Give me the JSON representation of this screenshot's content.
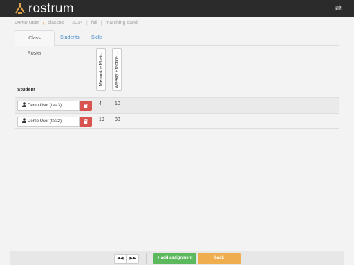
{
  "app": {
    "name": "rostrum",
    "logo_icon": "lectern-icon",
    "swap_icon": "swap-arrows-icon"
  },
  "breadcrumb": {
    "user": "Demo User",
    "items": [
      "classes",
      "2014",
      "fall",
      "marching band"
    ]
  },
  "tabs": [
    {
      "label": "Class Roster",
      "active": true
    },
    {
      "label": "Students",
      "active": false
    },
    {
      "label": "Skills",
      "active": false
    }
  ],
  "table": {
    "student_header": "Student",
    "columns": [
      "Memorize Music",
      "Weekly Practice ..."
    ],
    "rows": [
      {
        "student": "Demo User (test3)",
        "values": [
          "4",
          "10"
        ]
      },
      {
        "student": "Demo User (test2)",
        "values": [
          "19",
          "33"
        ]
      }
    ]
  },
  "footer": {
    "prev_glyph": "◀◀",
    "next_glyph": "▶▶",
    "add_label": "add assignment",
    "add_glyph": "+",
    "back_label": "back"
  },
  "colors": {
    "header_bg": "#2b2b2b",
    "accent": "#f0ad4e",
    "link": "#428bca",
    "danger": "#d9534f",
    "success": "#5cb85c"
  }
}
